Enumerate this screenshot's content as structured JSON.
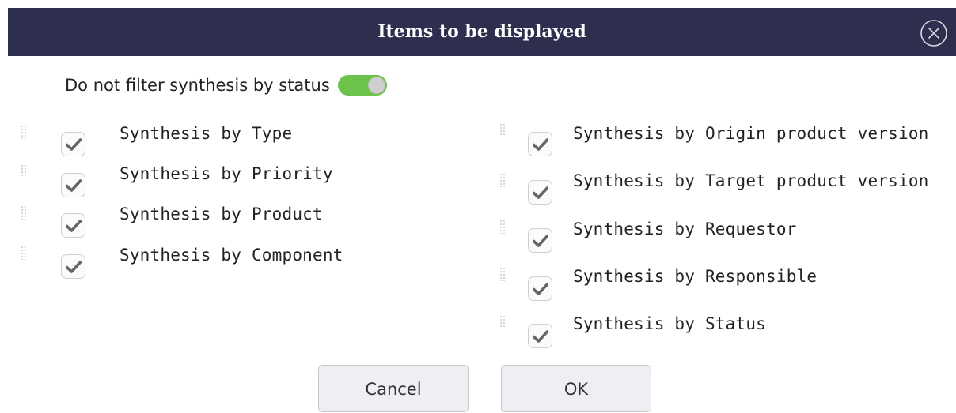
{
  "dialog": {
    "title": "Items to be displayed",
    "close_icon": "close-circle-icon",
    "header_color": "#2e2f4f"
  },
  "status_filter": {
    "label": "Do not filter synthesis by status",
    "toggle_on": true,
    "toggle_color": "#6cc24a"
  },
  "left_items": [
    {
      "label": "Synthesis by Type",
      "checked": true
    },
    {
      "label": "Synthesis by Priority",
      "checked": true
    },
    {
      "label": "Synthesis by Product",
      "checked": true
    },
    {
      "label": "Synthesis by Component",
      "checked": true
    }
  ],
  "right_items": [
    {
      "label": "Synthesis by Origin product version",
      "checked": true
    },
    {
      "label": "Synthesis by Target product version",
      "checked": true
    },
    {
      "label": "Synthesis by Requestor",
      "checked": true
    },
    {
      "label": "Synthesis by Responsible",
      "checked": true
    },
    {
      "label": "Synthesis by Status",
      "checked": true
    }
  ],
  "buttons": {
    "cancel": "Cancel",
    "ok": "OK"
  }
}
